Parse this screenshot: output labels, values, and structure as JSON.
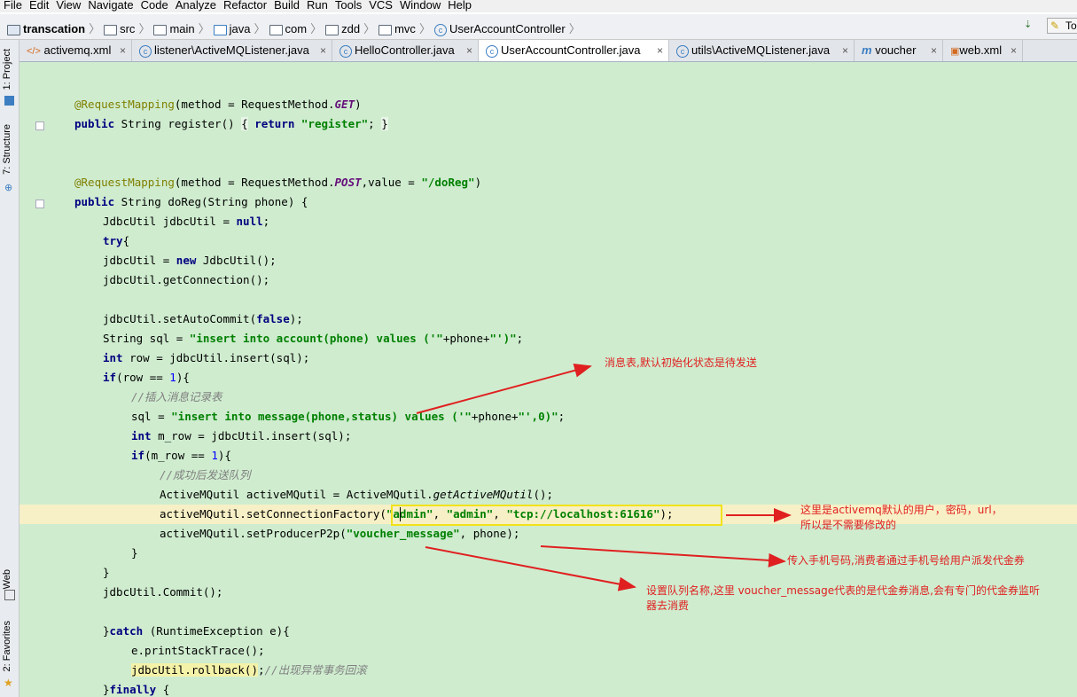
{
  "menu": [
    "File",
    "Edit",
    "View",
    "Navigate",
    "Code",
    "Analyze",
    "Refactor",
    "Build",
    "Run",
    "Tools",
    "VCS",
    "Window",
    "Help"
  ],
  "breadcrumb": {
    "project": "transcation",
    "items": [
      "src",
      "main",
      "java",
      "com",
      "zdd",
      "mvc"
    ],
    "file": "UserAccountController",
    "tool_label": "To"
  },
  "tabs": [
    {
      "label": "activemq.xml",
      "icon": "xml-icon"
    },
    {
      "label": "listener\\ActiveMQListener.java",
      "icon": "class-icon"
    },
    {
      "label": "HelloController.java",
      "icon": "class-icon"
    },
    {
      "label": "UserAccountController.java",
      "icon": "class-icon",
      "active": true
    },
    {
      "label": "utils\\ActiveMQListener.java",
      "icon": "class-icon"
    },
    {
      "label": "voucher",
      "icon": "module-icon"
    },
    {
      "label": "web.xml",
      "icon": "xml-icon"
    }
  ],
  "close_glyph": "×",
  "side_tabs": {
    "project": "1: Project",
    "structure": "7: Structure",
    "web": "Web",
    "favorites": "2: Favorites"
  },
  "annotations": {
    "message_table": "消息表,默认初始化状态是待发送",
    "default_user_line1": "这里是activemq默认的用户，密码，url，",
    "default_user_line2": "所以是不需要修改的",
    "phone": "传入手机号码,消费者通过手机号给用户派发代金券",
    "queue_line1": "设置队列名称,这里    voucher_message代表的是代金券消息,会有专门的代金券监听",
    "queue_line2": "器去消费"
  },
  "colors": {
    "editor_bg": "#cfeccf",
    "annotation": "#e02020",
    "highlight_box": "#f2e21a"
  }
}
